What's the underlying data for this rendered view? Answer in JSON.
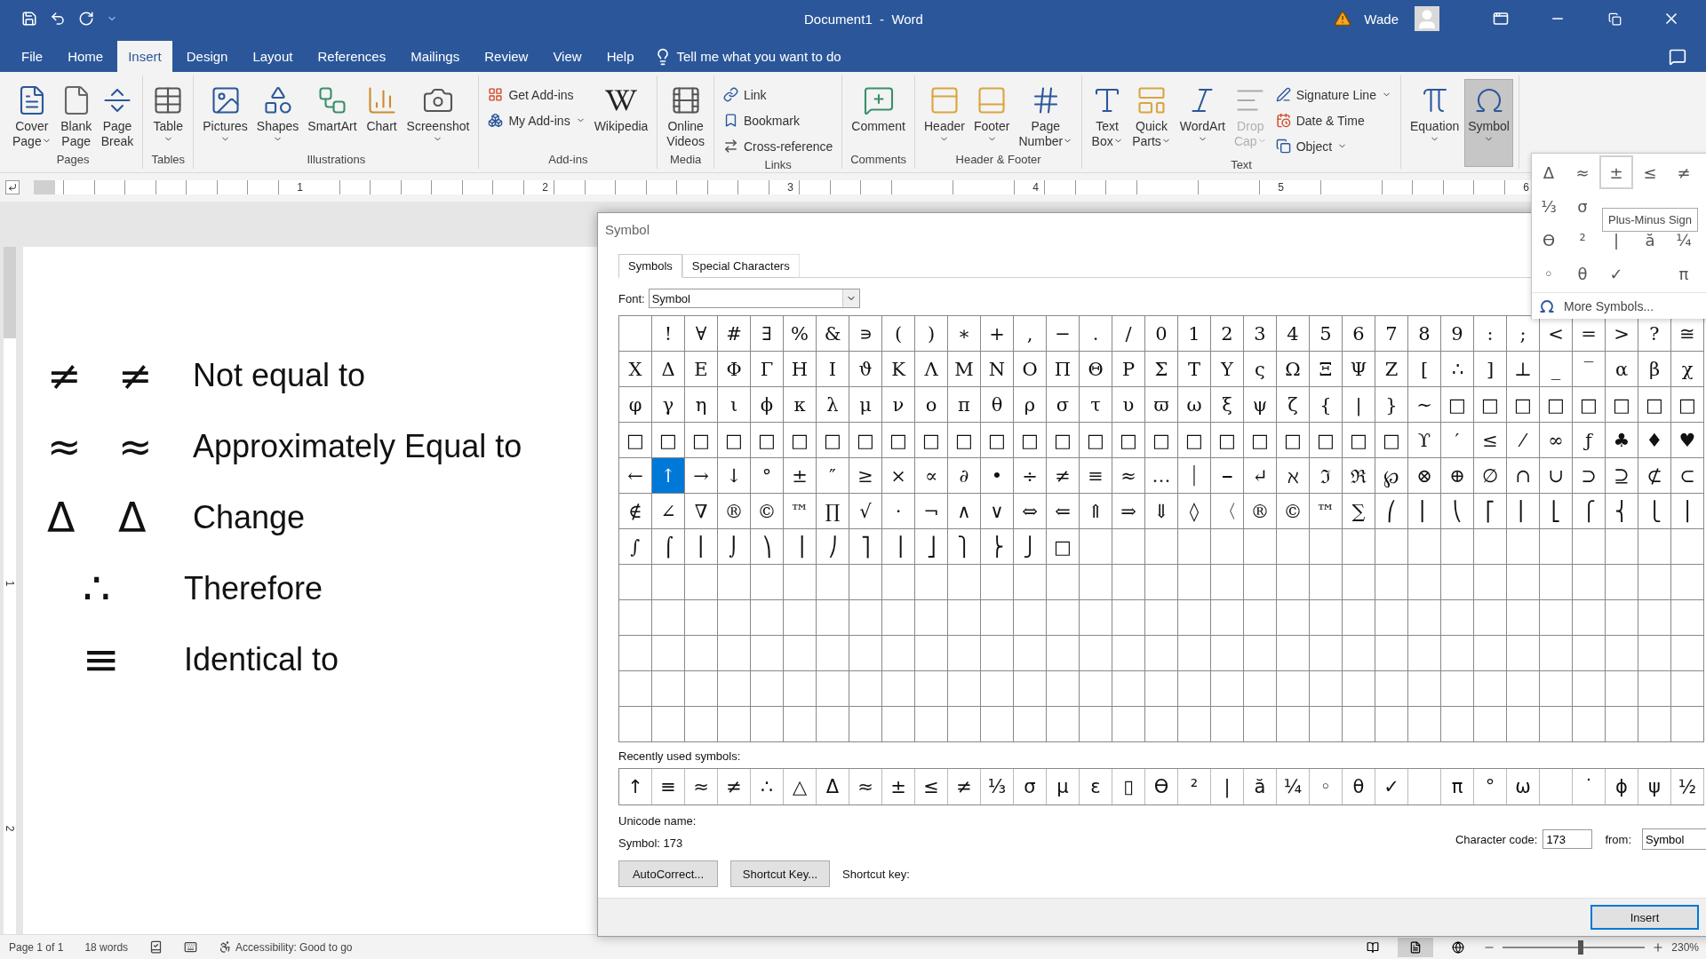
{
  "title_bar": {
    "title": "Document1  -  Word",
    "user": "Wade"
  },
  "menu_tabs": [
    {
      "label": "File",
      "selected": false
    },
    {
      "label": "Home",
      "selected": false
    },
    {
      "label": "Insert",
      "selected": true
    },
    {
      "label": "Design",
      "selected": false
    },
    {
      "label": "Layout",
      "selected": false
    },
    {
      "label": "References",
      "selected": false
    },
    {
      "label": "Mailings",
      "selected": false
    },
    {
      "label": "Review",
      "selected": false
    },
    {
      "label": "View",
      "selected": false
    },
    {
      "label": "Help",
      "selected": false
    }
  ],
  "tell_me": "Tell me what you want to do",
  "ribbon": [
    {
      "label": "Pages",
      "items": [
        {
          "kind": "large",
          "lines": [
            "Cover",
            "Page"
          ],
          "dropdown": true,
          "disabled": false,
          "selected": false
        },
        {
          "kind": "large",
          "lines": [
            "Blank",
            "Page"
          ],
          "dropdown": false,
          "disabled": false,
          "selected": false
        },
        {
          "kind": "large",
          "lines": [
            "Page",
            "Break"
          ],
          "dropdown": false,
          "disabled": false,
          "selected": false
        }
      ]
    },
    {
      "label": "Tables",
      "items": [
        {
          "kind": "large",
          "lines": [
            "Table"
          ],
          "dropdown": true,
          "disabled": false,
          "selected": false
        }
      ]
    },
    {
      "label": "Illustrations",
      "items": [
        {
          "kind": "large",
          "lines": [
            "Pictures"
          ],
          "dropdown": true,
          "disabled": false,
          "selected": false
        },
        {
          "kind": "large",
          "lines": [
            "Shapes"
          ],
          "dropdown": true,
          "disabled": false,
          "selected": false
        },
        {
          "kind": "large",
          "lines": [
            "SmartArt"
          ],
          "dropdown": false,
          "disabled": false,
          "selected": false
        },
        {
          "kind": "large",
          "lines": [
            "Chart"
          ],
          "dropdown": false,
          "disabled": false,
          "selected": false
        },
        {
          "kind": "large",
          "lines": [
            "Screenshot"
          ],
          "dropdown": true,
          "disabled": false,
          "selected": false
        }
      ]
    },
    {
      "label": "Add-ins",
      "items": [
        {
          "kind": "small",
          "lines": [
            "Get Add-ins"
          ],
          "dropdown": false,
          "disabled": false,
          "selected": false
        },
        {
          "kind": "small",
          "lines": [
            "My Add-ins"
          ],
          "dropdown": true,
          "disabled": false,
          "selected": false
        },
        {
          "kind": "large",
          "lines": [
            "Wikipedia"
          ],
          "dropdown": false,
          "disabled": false,
          "selected": false
        }
      ]
    },
    {
      "label": "Media",
      "items": [
        {
          "kind": "large",
          "lines": [
            "Online",
            "Videos"
          ],
          "dropdown": false,
          "disabled": false,
          "selected": false
        }
      ]
    },
    {
      "label": "Links",
      "items": [
        {
          "kind": "small",
          "lines": [
            "Link"
          ],
          "dropdown": false,
          "disabled": false,
          "selected": false
        },
        {
          "kind": "small",
          "lines": [
            "Bookmark"
          ],
          "dropdown": false,
          "disabled": false,
          "selected": false
        },
        {
          "kind": "small",
          "lines": [
            "Cross-reference"
          ],
          "dropdown": false,
          "disabled": false,
          "selected": false
        }
      ]
    },
    {
      "label": "Comments",
      "items": [
        {
          "kind": "large",
          "lines": [
            "Comment"
          ],
          "dropdown": false,
          "disabled": false,
          "selected": false
        }
      ]
    },
    {
      "label": "Header & Footer",
      "items": [
        {
          "kind": "large",
          "lines": [
            "Header"
          ],
          "dropdown": true,
          "disabled": false,
          "selected": false
        },
        {
          "kind": "large",
          "lines": [
            "Footer"
          ],
          "dropdown": true,
          "disabled": false,
          "selected": false
        },
        {
          "kind": "large",
          "lines": [
            "Page",
            "Number"
          ],
          "dropdown": true,
          "disabled": false,
          "selected": false
        }
      ]
    },
    {
      "label": "Text",
      "items": [
        {
          "kind": "large",
          "lines": [
            "Text",
            "Box"
          ],
          "dropdown": true,
          "disabled": false,
          "selected": false
        },
        {
          "kind": "large",
          "lines": [
            "Quick",
            "Parts"
          ],
          "dropdown": true,
          "disabled": false,
          "selected": false
        },
        {
          "kind": "large",
          "lines": [
            "WordArt"
          ],
          "dropdown": true,
          "disabled": false,
          "selected": false
        },
        {
          "kind": "large",
          "lines": [
            "Drop",
            "Cap"
          ],
          "dropdown": true,
          "disabled": true,
          "selected": false
        },
        {
          "kind": "small",
          "lines": [
            "Signature Line"
          ],
          "dropdown": true,
          "disabled": false,
          "selected": false
        },
        {
          "kind": "small",
          "lines": [
            "Date & Time"
          ],
          "dropdown": false,
          "disabled": false,
          "selected": false
        },
        {
          "kind": "small",
          "lines": [
            "Object"
          ],
          "dropdown": true,
          "disabled": false,
          "selected": false
        }
      ]
    },
    {
      "items": [
        {
          "kind": "large",
          "lines": [
            "Equation"
          ],
          "dropdown": true,
          "disabled": false,
          "selected": false
        },
        {
          "kind": "large",
          "lines": [
            "Symbol"
          ],
          "dropdown": true,
          "disabled": false,
          "selected": true
        }
      ]
    }
  ],
  "ruler": [
    "1",
    "2",
    "3",
    "4",
    "5",
    "6"
  ],
  "vertical_ruler": [
    "1",
    "2"
  ],
  "document": [
    {
      "kind": "pair",
      "symbols": [
        "≠",
        "≠"
      ],
      "text": "Not equal to"
    },
    {
      "kind": "pair",
      "symbols": [
        "≈",
        "≈"
      ],
      "text": "Approximately Equal to"
    },
    {
      "kind": "pair",
      "symbols": [
        "Δ",
        "Δ"
      ],
      "text": "Change"
    },
    {
      "kind": "single",
      "symbols": [
        "∴"
      ],
      "text": "Therefore"
    },
    {
      "kind": "single",
      "symbols": [
        "≡"
      ],
      "text": "Identical to"
    }
  ],
  "dialog": {
    "title": "Symbol",
    "tabs": [
      {
        "label": "Symbols",
        "selected": true
      },
      {
        "label": "Special Characters",
        "selected": false
      }
    ],
    "font_label": "Font:",
    "font_value": "Symbol",
    "grid": [
      [
        {
          "selected": false
        },
        {
          "char": "!",
          "selected": false
        },
        {
          "char": "∀",
          "selected": false
        },
        {
          "char": "#",
          "selected": false
        },
        {
          "char": "∃",
          "selected": false
        },
        {
          "char": "%",
          "selected": false
        },
        {
          "char": "&",
          "selected": false
        },
        {
          "char": "∍",
          "selected": false
        },
        {
          "char": "(",
          "selected": false
        },
        {
          "char": ")",
          "selected": false
        },
        {
          "char": "∗",
          "selected": false
        },
        {
          "char": "+",
          "selected": false
        },
        {
          "char": ",",
          "selected": false
        },
        {
          "char": "−",
          "selected": false
        },
        {
          "char": ".",
          "selected": false
        },
        {
          "char": "/",
          "selected": false
        },
        {
          "char": "0",
          "selected": false
        },
        {
          "char": "1",
          "selected": false
        },
        {
          "char": "2",
          "selected": false
        },
        {
          "char": "3",
          "selected": false
        },
        {
          "char": "4",
          "selected": false
        },
        {
          "char": "5",
          "selected": false
        },
        {
          "char": "6",
          "selected": false
        },
        {
          "char": "7",
          "selected": false
        },
        {
          "char": "8",
          "selected": false
        },
        {
          "char": "9",
          "selected": false
        },
        {
          "char": ":",
          "selected": false
        },
        {
          "char": ";",
          "selected": false
        },
        {
          "char": "<",
          "selected": false
        },
        {
          "char": "=",
          "selected": false
        },
        {
          "char": ">",
          "selected": false
        },
        {
          "char": "?",
          "selected": false
        },
        {
          "char": "≅",
          "selected": false
        }
      ],
      [
        {
          "char": "Χ",
          "selected": false
        },
        {
          "char": "Δ",
          "selected": false
        },
        {
          "char": "Ε",
          "selected": false
        },
        {
          "char": "Φ",
          "selected": false
        },
        {
          "char": "Γ",
          "selected": false
        },
        {
          "char": "Η",
          "selected": false
        },
        {
          "char": "Ι",
          "selected": false
        },
        {
          "char": "ϑ",
          "selected": false
        },
        {
          "char": "Κ",
          "selected": false
        },
        {
          "char": "Λ",
          "selected": false
        },
        {
          "char": "Μ",
          "selected": false
        },
        {
          "char": "Ν",
          "selected": false
        },
        {
          "char": "Ο",
          "selected": false
        },
        {
          "char": "Π",
          "selected": false
        },
        {
          "char": "Θ",
          "selected": false
        },
        {
          "char": "Ρ",
          "selected": false
        },
        {
          "char": "Σ",
          "selected": false
        },
        {
          "char": "Τ",
          "selected": false
        },
        {
          "char": "Υ",
          "selected": false
        },
        {
          "char": "ς",
          "selected": false
        },
        {
          "char": "Ω",
          "selected": false
        },
        {
          "char": "Ξ",
          "selected": false
        },
        {
          "char": "Ψ",
          "selected": false
        },
        {
          "char": "Ζ",
          "selected": false
        },
        {
          "char": "[",
          "selected": false
        },
        {
          "char": "∴",
          "selected": false
        },
        {
          "char": "]",
          "selected": false
        },
        {
          "char": "⊥",
          "selected": false
        },
        {
          "char": "_",
          "selected": false
        },
        {
          "char": "‾",
          "selected": false
        },
        {
          "char": "α",
          "selected": false
        },
        {
          "char": "β",
          "selected": false
        },
        {
          "char": "χ",
          "selected": false
        }
      ],
      [
        {
          "char": "φ",
          "selected": false
        },
        {
          "char": "γ",
          "selected": false
        },
        {
          "char": "η",
          "selected": false
        },
        {
          "char": "ι",
          "selected": false
        },
        {
          "char": "ϕ",
          "selected": false
        },
        {
          "char": "κ",
          "selected": false
        },
        {
          "char": "λ",
          "selected": false
        },
        {
          "char": "μ",
          "selected": false
        },
        {
          "char": "ν",
          "selected": false
        },
        {
          "char": "ο",
          "selected": false
        },
        {
          "char": "π",
          "selected": false
        },
        {
          "char": "θ",
          "selected": false
        },
        {
          "char": "ρ",
          "selected": false
        },
        {
          "char": "σ",
          "selected": false
        },
        {
          "char": "τ",
          "selected": false
        },
        {
          "char": "υ",
          "selected": false
        },
        {
          "char": "ϖ",
          "selected": false
        },
        {
          "char": "ω",
          "selected": false
        },
        {
          "char": "ξ",
          "selected": false
        },
        {
          "char": "ψ",
          "selected": false
        },
        {
          "char": "ζ",
          "selected": false
        },
        {
          "char": "{",
          "selected": false
        },
        {
          "char": "|",
          "selected": false
        },
        {
          "char": "}",
          "selected": false
        },
        {
          "char": "∼",
          "selected": false
        },
        {
          "char": "□",
          "selected": false
        },
        {
          "char": "□",
          "selected": false
        },
        {
          "char": "□",
          "selected": false
        },
        {
          "char": "□",
          "selected": false
        },
        {
          "char": "□",
          "selected": false
        },
        {
          "char": "□",
          "selected": false
        },
        {
          "char": "□",
          "selected": false
        },
        {
          "char": "□",
          "selected": false
        }
      ],
      [
        {
          "char": "□",
          "selected": false
        },
        {
          "char": "□",
          "selected": false
        },
        {
          "char": "□",
          "selected": false
        },
        {
          "char": "□",
          "selected": false
        },
        {
          "char": "□",
          "selected": false
        },
        {
          "char": "□",
          "selected": false
        },
        {
          "char": "□",
          "selected": false
        },
        {
          "char": "□",
          "selected": false
        },
        {
          "char": "□",
          "selected": false
        },
        {
          "char": "□",
          "selected": false
        },
        {
          "char": "□",
          "selected": false
        },
        {
          "char": "□",
          "selected": false
        },
        {
          "char": "□",
          "selected": false
        },
        {
          "char": "□",
          "selected": false
        },
        {
          "char": "□",
          "selected": false
        },
        {
          "char": "□",
          "selected": false
        },
        {
          "char": "□",
          "selected": false
        },
        {
          "char": "□",
          "selected": false
        },
        {
          "char": "□",
          "selected": false
        },
        {
          "char": "□",
          "selected": false
        },
        {
          "char": "□",
          "selected": false
        },
        {
          "char": "□",
          "selected": false
        },
        {
          "char": "□",
          "selected": false
        },
        {
          "char": "□",
          "selected": false
        },
        {
          "char": "ϒ",
          "selected": false
        },
        {
          "char": "′",
          "selected": false
        },
        {
          "char": "≤",
          "selected": false
        },
        {
          "char": "⁄",
          "selected": false
        },
        {
          "char": "∞",
          "selected": false
        },
        {
          "char": "ƒ",
          "selected": false
        },
        {
          "char": "♣",
          "selected": false
        },
        {
          "char": "♦",
          "selected": false
        },
        {
          "char": "♥",
          "selected": false
        }
      ],
      [
        {
          "char": "←",
          "selected": false
        },
        {
          "char": "↑",
          "selected": true
        },
        {
          "char": "→",
          "selected": false
        },
        {
          "char": "↓",
          "selected": false
        },
        {
          "char": "°",
          "selected": false
        },
        {
          "char": "±",
          "selected": false
        },
        {
          "char": "″",
          "selected": false
        },
        {
          "char": "≥",
          "selected": false
        },
        {
          "char": "×",
          "selected": false
        },
        {
          "char": "∝",
          "selected": false
        },
        {
          "char": "∂",
          "selected": false
        },
        {
          "char": "•",
          "selected": false
        },
        {
          "char": "÷",
          "selected": false
        },
        {
          "char": "≠",
          "selected": false
        },
        {
          "char": "≡",
          "selected": false
        },
        {
          "char": "≈",
          "selected": false
        },
        {
          "char": "…",
          "selected": false
        },
        {
          "char": "⏐",
          "selected": false
        },
        {
          "char": "⎯",
          "selected": false
        },
        {
          "char": "↵",
          "selected": false
        },
        {
          "char": "ℵ",
          "selected": false
        },
        {
          "char": "ℑ",
          "selected": false
        },
        {
          "char": "ℜ",
          "selected": false
        },
        {
          "char": "℘",
          "selected": false
        },
        {
          "char": "⊗",
          "selected": false
        },
        {
          "char": "⊕",
          "selected": false
        },
        {
          "char": "∅",
          "selected": false
        },
        {
          "char": "∩",
          "selected": false
        },
        {
          "char": "∪",
          "selected": false
        },
        {
          "char": "⊃",
          "selected": false
        },
        {
          "char": "⊇",
          "selected": false
        },
        {
          "char": "⊄",
          "selected": false
        },
        {
          "char": "⊂",
          "selected": false
        }
      ],
      [
        {
          "char": "∉",
          "selected": false
        },
        {
          "char": "∠",
          "selected": false
        },
        {
          "char": "∇",
          "selected": false
        },
        {
          "char": "®",
          "selected": false
        },
        {
          "char": "©",
          "selected": false
        },
        {
          "char": "™",
          "selected": false
        },
        {
          "char": "∏",
          "selected": false
        },
        {
          "char": "√",
          "selected": false
        },
        {
          "char": "⋅",
          "selected": false
        },
        {
          "char": "¬",
          "selected": false
        },
        {
          "char": "∧",
          "selected": false
        },
        {
          "char": "∨",
          "selected": false
        },
        {
          "char": "⇔",
          "selected": false
        },
        {
          "char": "⇐",
          "selected": false
        },
        {
          "char": "⇑",
          "selected": false
        },
        {
          "char": "⇒",
          "selected": false
        },
        {
          "char": "⇓",
          "selected": false
        },
        {
          "char": "◊",
          "selected": false
        },
        {
          "char": "〈",
          "selected": false
        },
        {
          "char": "®",
          "selected": false
        },
        {
          "char": "©",
          "selected": false
        },
        {
          "char": "™",
          "selected": false
        },
        {
          "char": "∑",
          "selected": false
        },
        {
          "char": "⎛",
          "selected": false
        },
        {
          "char": "⎜",
          "selected": false
        },
        {
          "char": "⎝",
          "selected": false
        },
        {
          "char": "⎡",
          "selected": false
        },
        {
          "char": "⎢",
          "selected": false
        },
        {
          "char": "⎣",
          "selected": false
        },
        {
          "char": "⎧",
          "selected": false
        },
        {
          "char": "⎨",
          "selected": false
        },
        {
          "char": "⎩",
          "selected": false
        },
        {
          "char": "⎪",
          "selected": false
        }
      ],
      [
        {
          "char": "∫",
          "selected": false
        },
        {
          "char": "⌠",
          "selected": false
        },
        {
          "char": "⎮",
          "selected": false
        },
        {
          "char": "⌡",
          "selected": false
        },
        {
          "char": "⎞",
          "selected": false
        },
        {
          "char": "⎟",
          "selected": false
        },
        {
          "char": "⎠",
          "selected": false
        },
        {
          "char": "⎤",
          "selected": false
        },
        {
          "char": "⎥",
          "selected": false
        },
        {
          "char": "⎦",
          "selected": false
        },
        {
          "char": "⎫",
          "selected": false
        },
        {
          "char": "⎬",
          "selected": false
        },
        {
          "char": "⎭",
          "selected": false
        },
        {
          "char": "□",
          "selected": false
        }
      ]
    ],
    "recent_label": "Recently used symbols:",
    "recent": [
      {
        "char": "↑"
      },
      {
        "char": "≡"
      },
      {
        "char": "≈"
      },
      {
        "char": "≠"
      },
      {
        "char": "∴"
      },
      {
        "char": "△"
      },
      {
        "char": "Δ"
      },
      {
        "char": "≈"
      },
      {
        "char": "±"
      },
      {
        "char": "≤"
      },
      {
        "char": "≠"
      },
      {
        "char": "⅓"
      },
      {
        "char": "σ"
      },
      {
        "char": "μ"
      },
      {
        "char": "ε"
      },
      {
        "char": "▯"
      },
      {
        "char": "ϴ"
      },
      {
        "char": "²"
      },
      {
        "char": "|"
      },
      {
        "char": "ă"
      },
      {
        "char": "¼"
      },
      {
        "char": "◦"
      },
      {
        "char": "θ"
      },
      {
        "char": "✓"
      },
      {
        "kind": "blank"
      },
      {
        "char": "π"
      },
      {
        "char": "°"
      },
      {
        "char": "ω"
      },
      {
        "kind": "blank"
      },
      {
        "char": "˙"
      },
      {
        "char": "ϕ"
      },
      {
        "char": "ψ"
      },
      {
        "char": "½"
      }
    ],
    "unicode_name_label": "Unicode name:",
    "symbol_code": "Symbol: 173",
    "character_code_label": "Character code:",
    "character_code": "173",
    "from_label": "from:",
    "from_value": "Symbol",
    "buttons": [
      "AutoCorrect...",
      "Shortcut Key..."
    ],
    "shortcut_label": "Shortcut key:",
    "insert": "Insert"
  },
  "gallery": {
    "items": [
      {
        "char": "Δ",
        "selected": false
      },
      {
        "char": "≈",
        "selected": false
      },
      {
        "char": "±",
        "selected": true
      },
      {
        "char": "≤",
        "selected": false
      },
      {
        "char": "≠",
        "selected": false
      },
      {
        "char": "⅓",
        "selected": false
      },
      {
        "char": "σ",
        "selected": false
      },
      {
        "kind": "blank"
      },
      {
        "kind": "blank"
      },
      {
        "kind": "blank"
      },
      {
        "char": "ϴ",
        "selected": false
      },
      {
        "char": "²",
        "selected": false
      },
      {
        "char": "|",
        "selected": false
      },
      {
        "char": "ă",
        "selected": false
      },
      {
        "char": "¼",
        "selected": false
      },
      {
        "char": "◦",
        "selected": false
      },
      {
        "char": "θ",
        "selected": false
      },
      {
        "char": "✓",
        "selected": false
      },
      {
        "kind": "blank"
      },
      {
        "char": "π",
        "selected": false
      }
    ],
    "more": "More Symbols...",
    "tooltip": "Plus-Minus Sign"
  },
  "status_bar": {
    "page": "Page 1 of 1",
    "words": "18 words",
    "accessibility": "Accessibility: Good to go",
    "views": [
      {
        "selected": false
      },
      {
        "selected": true
      },
      {
        "selected": false
      }
    ],
    "zoom": {
      "level": 0.55,
      "reading": "230%"
    }
  }
}
